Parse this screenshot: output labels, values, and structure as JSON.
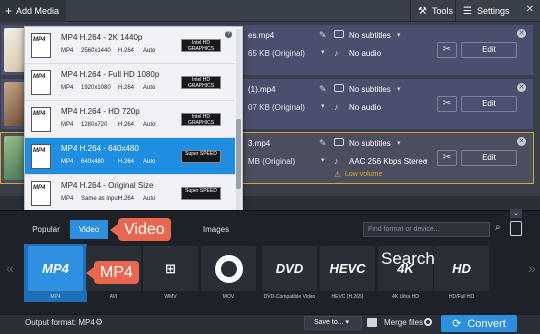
{
  "toolbar": {
    "add_media": "Add Media",
    "tools": "Tools",
    "settings": "Settings"
  },
  "files": [
    {
      "name": "es.mp4",
      "size": "65 KB (Original)",
      "subtitles": "No subtitles",
      "audio": "No audio",
      "edit": "Edit"
    },
    {
      "name": "(1).mp4",
      "size": "07 KB (Original)",
      "subtitles": "No subtitles",
      "audio": "No audio",
      "edit": "Edit"
    },
    {
      "name": "3.mp4",
      "size": "MB (Original)",
      "subtitles": "No subtitles",
      "audio": "AAC 256 Kbps Stereo",
      "edit": "Edit",
      "warning": "Low volume"
    }
  ],
  "dropdown": {
    "items": [
      {
        "title": "MP4 H.264 - 2K 1440p",
        "specs": [
          "MP4",
          "2560x1440",
          "H.264",
          "Auto"
        ],
        "badge": "Intel HD GRAPHICS",
        "icon_text": "MP4"
      },
      {
        "title": "MP4 H.264 - Full HD 1080p",
        "specs": [
          "MP4",
          "1920x1080",
          "H.264",
          "Auto"
        ],
        "badge": "Intel HD GRAPHICS",
        "icon_text": "MP4"
      },
      {
        "title": "MP4 H.264 - HD 720p",
        "specs": [
          "MP4",
          "1280x720",
          "H.264",
          "Auto"
        ],
        "badge": "Intel HD GRAPHICS",
        "icon_text": "MP4"
      },
      {
        "title": "MP4 H.264 - 640x480",
        "specs": [
          "MP4",
          "640x480",
          "H.264",
          "Auto"
        ],
        "badge": "Super SPEED",
        "icon_text": "MP4",
        "selected": true
      },
      {
        "title": "MP4 H.264 - Original Size",
        "specs": [
          "MP4",
          "Same as input",
          "H.264",
          "Auto"
        ],
        "badge": "Super SPEED",
        "icon_text": "MP4"
      }
    ]
  },
  "format_panel": {
    "tabs": [
      "Popular",
      "Video",
      "Images"
    ],
    "active_tab": "Video",
    "search_placeholder": "Find format or device...",
    "formats": [
      {
        "label": "MP4",
        "tile": "MP4",
        "selected": true
      },
      {
        "label": "AVI",
        "tile": ""
      },
      {
        "label": "WMV",
        "tile": ""
      },
      {
        "label": "MOV",
        "tile": ""
      },
      {
        "label": "DVD-Compatible Video",
        "tile": "DVD"
      },
      {
        "label": "HEVC (H.265)",
        "tile": "HEVC"
      },
      {
        "label": "4K Ultra HD",
        "tile": "4K"
      },
      {
        "label": "HD/Full HD",
        "tile": "HD"
      }
    ]
  },
  "callouts": {
    "video": "Video",
    "mp4": "MP4",
    "search": "Search"
  },
  "bottom": {
    "output_format": "Output format: MP4",
    "save_to": "Save to...",
    "merge_files": "Merge files",
    "convert": "Convert"
  },
  "colors": {
    "accent": "#2c8fe0",
    "callout": "#e9674e",
    "warning": "#e3a82c"
  }
}
